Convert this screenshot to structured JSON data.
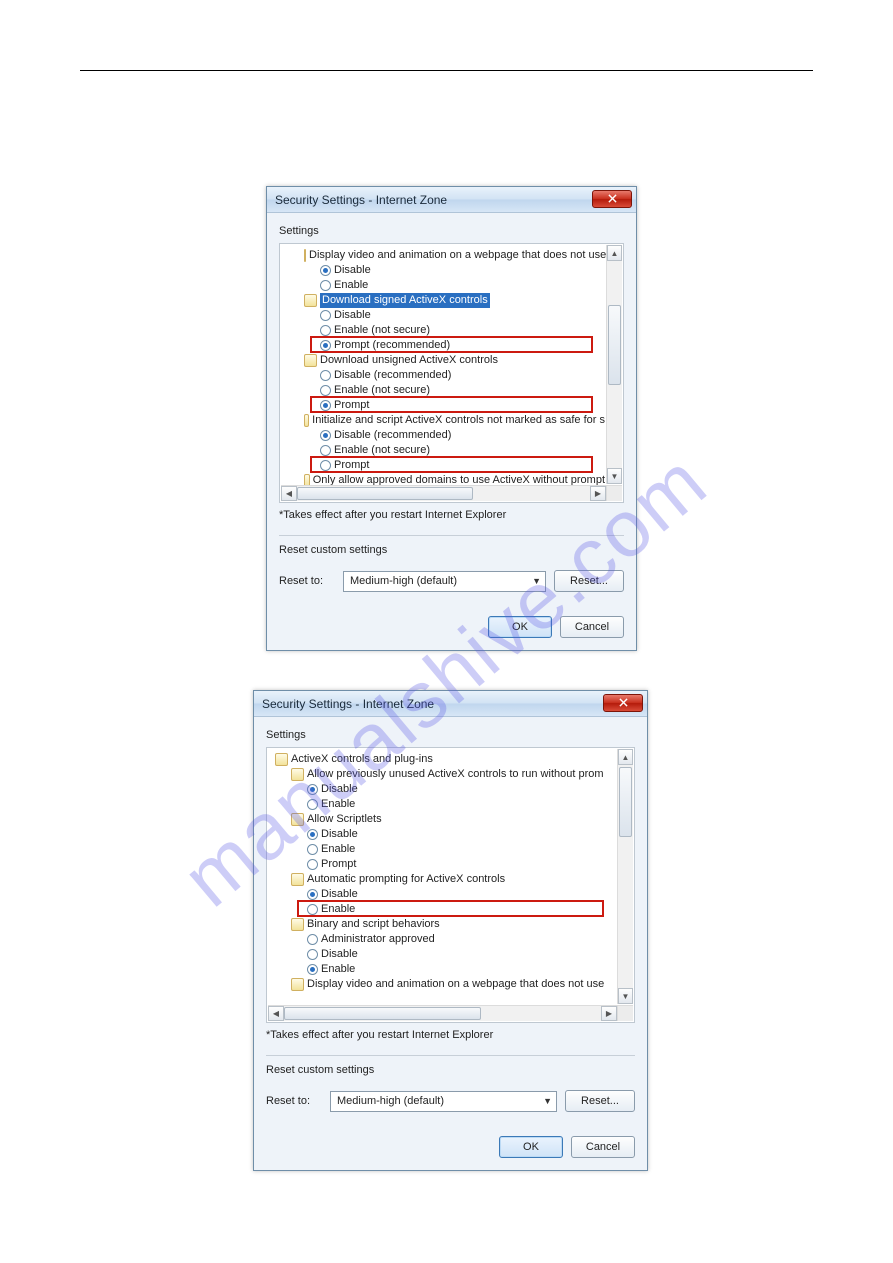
{
  "watermark": "manualshive.com",
  "dlg1": {
    "title": "Security Settings - Internet Zone",
    "settings_label": "Settings",
    "items": [
      {
        "kind": "cat",
        "label": "Display video and animation on a webpage that does not use"
      },
      {
        "kind": "opt",
        "label": "Disable",
        "selected": true
      },
      {
        "kind": "opt",
        "label": "Enable",
        "selected": false
      },
      {
        "kind": "cat",
        "label": "Download signed ActiveX controls",
        "highlight": true
      },
      {
        "kind": "opt",
        "label": "Disable",
        "selected": false
      },
      {
        "kind": "opt",
        "label": "Enable (not secure)",
        "selected": false
      },
      {
        "kind": "opt",
        "label": "Prompt (recommended)",
        "selected": true,
        "boxed": true
      },
      {
        "kind": "cat",
        "label": "Download unsigned ActiveX controls"
      },
      {
        "kind": "opt",
        "label": "Disable (recommended)",
        "selected": false
      },
      {
        "kind": "opt",
        "label": "Enable (not secure)",
        "selected": false
      },
      {
        "kind": "opt",
        "label": "Prompt",
        "selected": true,
        "boxed": true
      },
      {
        "kind": "cat",
        "label": "Initialize and script ActiveX controls not marked as safe for s"
      },
      {
        "kind": "opt",
        "label": "Disable (recommended)",
        "selected": true
      },
      {
        "kind": "opt",
        "label": "Enable (not secure)",
        "selected": false
      },
      {
        "kind": "opt",
        "label": "Prompt",
        "selected": false,
        "boxed": true
      },
      {
        "kind": "cat",
        "label": "Only allow approved domains to use ActiveX without prompt",
        "truncated": true
      }
    ],
    "note": "*Takes effect after you restart Internet Explorer",
    "reset_section_label": "Reset custom settings",
    "reset_to_label": "Reset to:",
    "reset_dropdown": "Medium-high (default)",
    "reset_button": "Reset...",
    "ok_button": "OK",
    "cancel_button": "Cancel"
  },
  "dlg2": {
    "title": "Security Settings - Internet Zone",
    "settings_label": "Settings",
    "items": [
      {
        "kind": "cat",
        "label": "ActiveX controls and plug-ins",
        "top": true
      },
      {
        "kind": "sub",
        "label": "Allow previously unused ActiveX controls to run without prom"
      },
      {
        "kind": "opt",
        "label": "Disable",
        "selected": true
      },
      {
        "kind": "opt",
        "label": "Enable",
        "selected": false
      },
      {
        "kind": "sub",
        "label": "Allow Scriptlets"
      },
      {
        "kind": "opt",
        "label": "Disable",
        "selected": true
      },
      {
        "kind": "opt",
        "label": "Enable",
        "selected": false
      },
      {
        "kind": "opt",
        "label": "Prompt",
        "selected": false
      },
      {
        "kind": "sub",
        "label": "Automatic prompting for ActiveX controls"
      },
      {
        "kind": "opt",
        "label": "Disable",
        "selected": true
      },
      {
        "kind": "opt",
        "label": "Enable",
        "selected": false,
        "boxed": true
      },
      {
        "kind": "sub",
        "label": "Binary and script behaviors"
      },
      {
        "kind": "opt",
        "label": "Administrator approved",
        "selected": false
      },
      {
        "kind": "opt",
        "label": "Disable",
        "selected": false
      },
      {
        "kind": "opt",
        "label": "Enable",
        "selected": true
      },
      {
        "kind": "sub",
        "label": "Display video and animation on a webpage that does not use",
        "truncated": true
      }
    ],
    "note": "*Takes effect after you restart Internet Explorer",
    "reset_section_label": "Reset custom settings",
    "reset_to_label": "Reset to:",
    "reset_dropdown": "Medium-high (default)",
    "reset_button": "Reset...",
    "ok_button": "OK",
    "cancel_button": "Cancel"
  }
}
